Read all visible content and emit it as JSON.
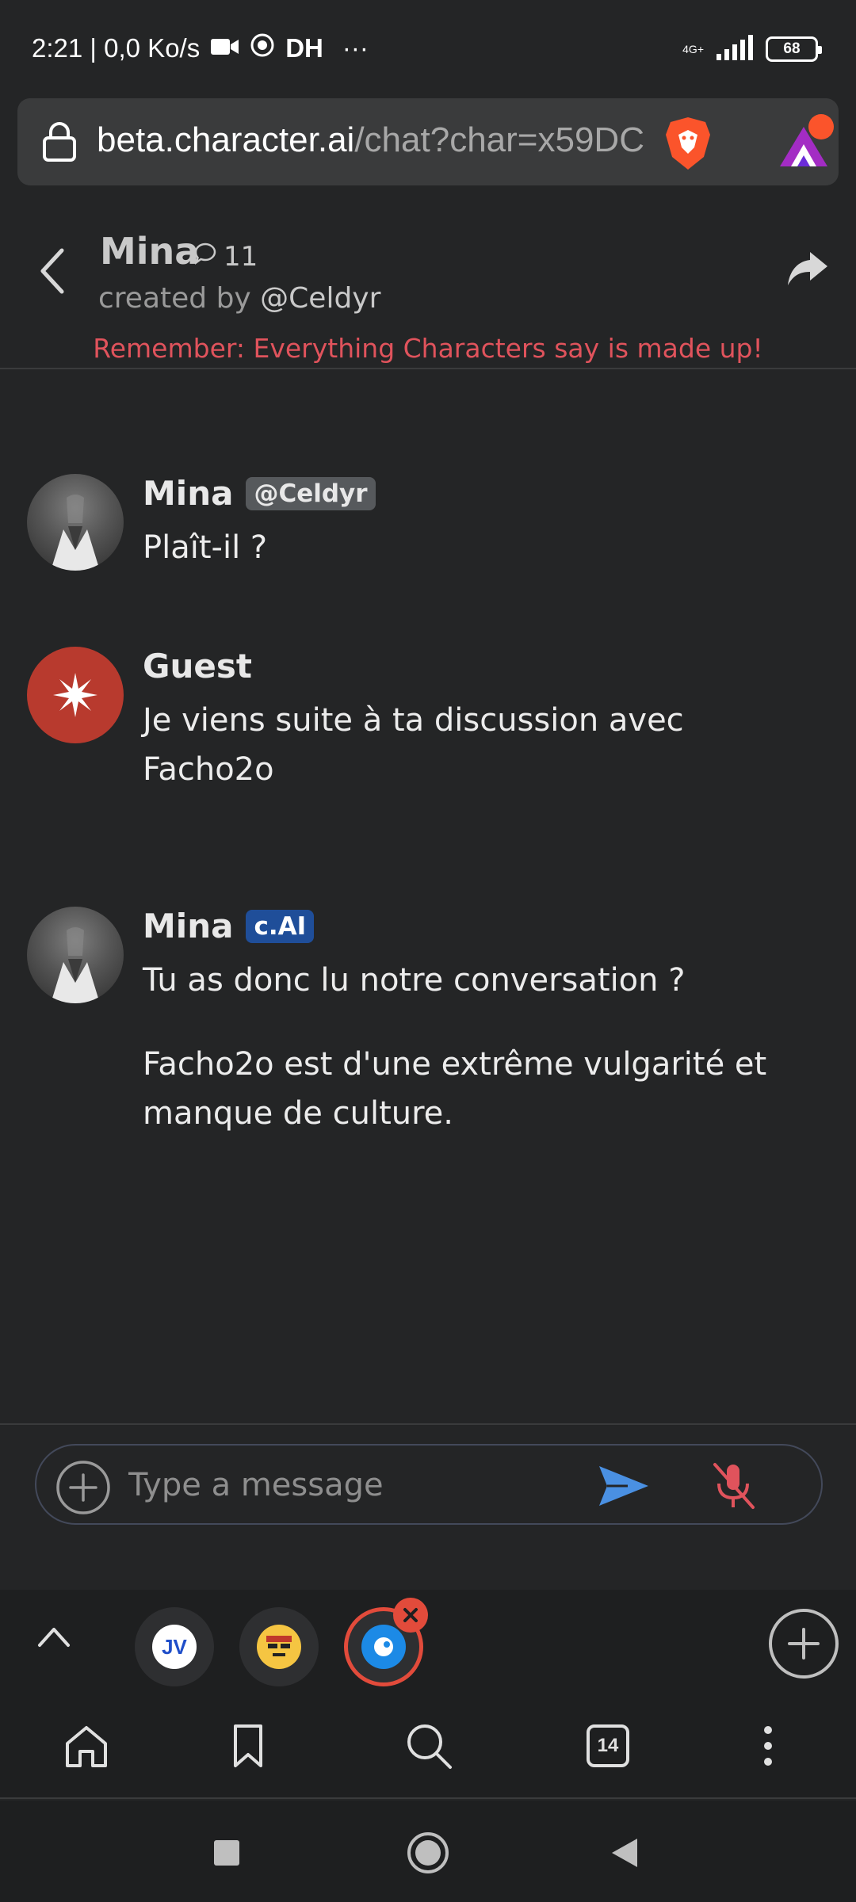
{
  "status_bar": {
    "time_speed": "2:21 | 0,0 Ko/s",
    "dh_label": "DH",
    "overflow": "···",
    "network": "4G+",
    "battery": "68"
  },
  "url_bar": {
    "host": "beta.character.ai",
    "path": "/chat?char=x59DC"
  },
  "chat_header": {
    "name": "Mina",
    "interaction_count": "11",
    "created_by_prefix": "created by ",
    "creator_handle": "@Celdyr",
    "disclaimer": "Remember: Everything Characters say is made up!"
  },
  "messages": [
    {
      "author": "Mina",
      "badge": "@Celdyr",
      "text": "Plaît-il ?"
    },
    {
      "author": "Guest",
      "text": "Je viens suite à ta discussion avec Facho2o"
    },
    {
      "author": "Mina",
      "badge": "c.AI",
      "text_1": "Tu as donc lu notre conversation ?",
      "text_2": "Facho2o est d'une extrême vulgarité et manque de culture."
    }
  ],
  "composer": {
    "placeholder": "Type a message"
  },
  "tabs": {
    "thumb_1": "JV",
    "count": "14"
  },
  "colors": {
    "background": "#242526",
    "disclaimer_red": "#e0535c",
    "badge_blue": "#1f4e99",
    "send_blue": "#4a90e2",
    "mic_red": "#e0535c",
    "guest_avatar": "#b83a2e"
  }
}
